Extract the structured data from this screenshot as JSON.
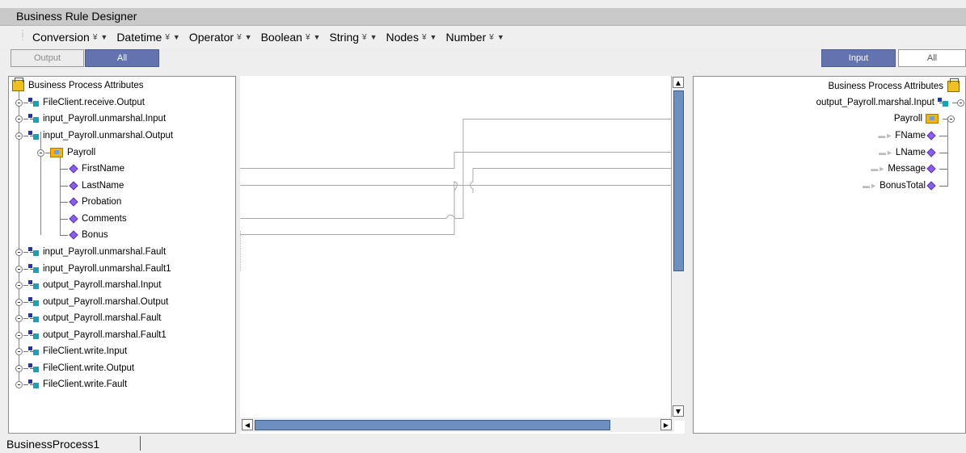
{
  "window": {
    "title": "Business Rule Designer"
  },
  "toolbar": {
    "menus": [
      {
        "label": "Conversion"
      },
      {
        "label": "Datetime"
      },
      {
        "label": "Operator"
      },
      {
        "label": "Boolean"
      },
      {
        "label": "String"
      },
      {
        "label": "Nodes"
      },
      {
        "label": "Number"
      }
    ]
  },
  "left_filter": {
    "output_label": "Output",
    "all_label": "All",
    "active": "All"
  },
  "right_filter": {
    "input_label": "Input",
    "all_label": "All",
    "active": "Input"
  },
  "left_tree": {
    "root": "Business Process Attributes",
    "nodes": [
      "FileClient.receive.Output",
      "input_Payroll.unmarshal.Input",
      "input_Payroll.unmarshal.Output"
    ],
    "payroll": {
      "label": "Payroll",
      "fields": [
        "FirstName",
        "LastName",
        "Probation",
        "Comments",
        "Bonus"
      ]
    },
    "nodes_after": [
      "input_Payroll.unmarshal.Fault",
      "input_Payroll.unmarshal.Fault1",
      "output_Payroll.marshal.Input",
      "output_Payroll.marshal.Output",
      "output_Payroll.marshal.Fault",
      "output_Payroll.marshal.Fault1",
      "FileClient.write.Input",
      "FileClient.write.Output",
      "FileClient.write.Fault"
    ]
  },
  "right_tree": {
    "root": "Business Process Attributes",
    "node": "output_Payroll.marshal.Input",
    "payroll": "Payroll",
    "fields": [
      "FName",
      "LName",
      "Message",
      "BonusTotal"
    ]
  },
  "mappings": [
    {
      "from": "Comments",
      "to": "FName"
    },
    {
      "from": "FirstName",
      "to": "LName"
    },
    {
      "from": "Bonus",
      "to": "Message"
    },
    {
      "from": "LastName",
      "to": "BonusTotal"
    }
  ],
  "status": {
    "text": "BusinessProcess1"
  }
}
